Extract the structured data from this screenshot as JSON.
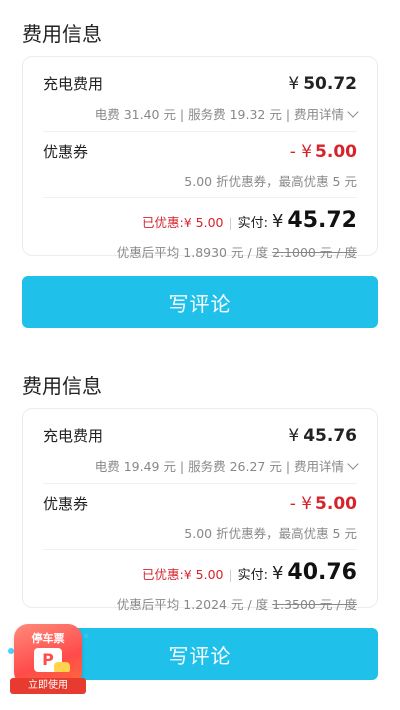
{
  "sections": [
    {
      "title": "费用信息",
      "charge_label": "充电费用",
      "currency": "¥",
      "charge_amount": "50.72",
      "breakdown": "电费 31.40 元 | 服务费 19.32 元 | 费用详情",
      "coupon_label": "优惠券",
      "coupon_prefix": "- ¥",
      "coupon_amount": "5.00",
      "coupon_desc": "5.00 折优惠券，最高优惠 5 元",
      "saved_text": "已优惠:¥ 5.00",
      "paid_label": "实付:",
      "paid_amount": "45.72",
      "avg_prefix": "优惠后平均 1.8930 元 / 度",
      "avg_original": "2.1000 元 / 度",
      "button_label": "写评论"
    },
    {
      "title": "费用信息",
      "charge_label": "充电费用",
      "currency": "¥",
      "charge_amount": "45.76",
      "breakdown": "电费 19.49 元 | 服务费 26.27 元 | 费用详情",
      "coupon_label": "优惠券",
      "coupon_prefix": "- ¥",
      "coupon_amount": "5.00",
      "coupon_desc": "5.00 折优惠券，最高优惠 5 元",
      "saved_text": "已优惠:¥ 5.00",
      "paid_label": "实付:",
      "paid_amount": "40.76",
      "avg_prefix": "优惠后平均 1.2024 元 / 度",
      "avg_original": "1.3500 元 / 度",
      "button_label": "写评论"
    }
  ],
  "float_badge": {
    "title": "停车票",
    "symbol": "P",
    "action": "立即使用"
  },
  "colors": {
    "accent": "#1fc1ea",
    "discount_red": "#d6232c",
    "muted": "#888888"
  }
}
